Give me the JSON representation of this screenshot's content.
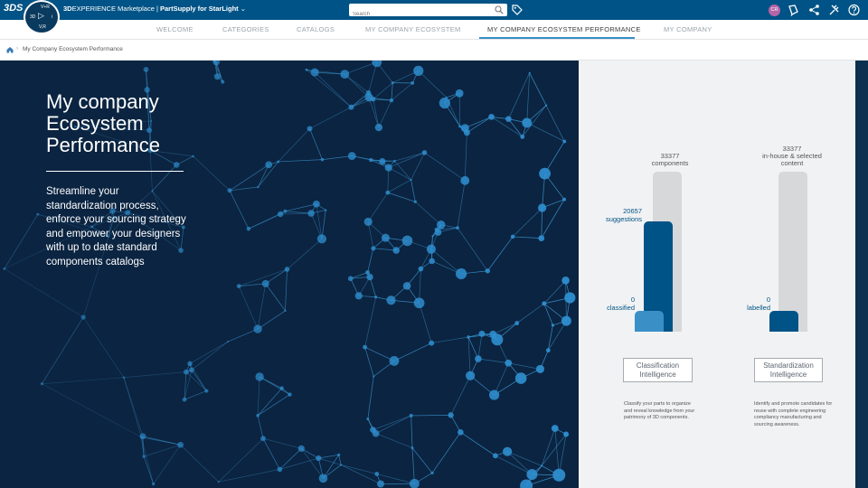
{
  "topbar": {
    "logo": "3DS",
    "app_title_brand": "3D",
    "app_title_rest": "EXPERIENCE Marketplace | ",
    "app_title_bold": "PartSupply for StarLight",
    "app_title_chevron": "⌄",
    "search_placeholder": "Search",
    "avatar_initials": "CR",
    "compass": {
      "north": "V+R",
      "west": "3D",
      "east": "i",
      "play": "▷",
      "south": "V,R"
    }
  },
  "nav": {
    "tabs": [
      {
        "label": "WELCOME"
      },
      {
        "label": "CATEGORIES"
      },
      {
        "label": "CATALOGS"
      },
      {
        "label": "MY COMPANY ECOSYSTEM"
      },
      {
        "label": "MY COMPANY ECOSYSTEM PERFORMANCE",
        "active": true
      },
      {
        "label": "MY COMPANY"
      }
    ]
  },
  "breadcrumb": {
    "separator": "›",
    "current": "My Company Ecosystem Performance"
  },
  "hero": {
    "title": "My company Ecosystem Performance",
    "description": "Streamline your standardization process, enforce your sourcing strategy and empower your designers with up to date standard components catalogs"
  },
  "classification": {
    "total_value": "33377",
    "total_label": "components",
    "suggestions_value": "20657",
    "suggestions_label": "suggestions",
    "classified_value": "0",
    "classified_label": "classified",
    "button_label": "Classification Intelligence",
    "description": "Classify your parts to organize and reveal knowledge from your patrimony of 3D components.",
    "bars": {
      "total": 33377,
      "suggestions": 20657,
      "classified": 0
    }
  },
  "standardization": {
    "total_value": "33377",
    "total_label": "in-house & selected content",
    "labelled_value": "0",
    "labelled_label": "labelled",
    "button_label": "Standardization Intelligence",
    "description": "Identify and promote candidates for reuse with complete engineering compliancy manufacturing and sourcing awareness.",
    "bars": {
      "total": 33377,
      "labelled": 0
    }
  },
  "colors": {
    "topbar": "#005386",
    "accent": "#368ec4",
    "bar_dark": "#005386",
    "bar_light": "#3a8fc7",
    "bar_track": "#d6d8da",
    "hero_bg": "#0b2441"
  },
  "icons": [
    "search-icon",
    "tag-icon",
    "compass-icon",
    "home-icon",
    "add-icon",
    "share-icon",
    "tools-icon",
    "help-icon",
    "chevron-down-icon"
  ]
}
